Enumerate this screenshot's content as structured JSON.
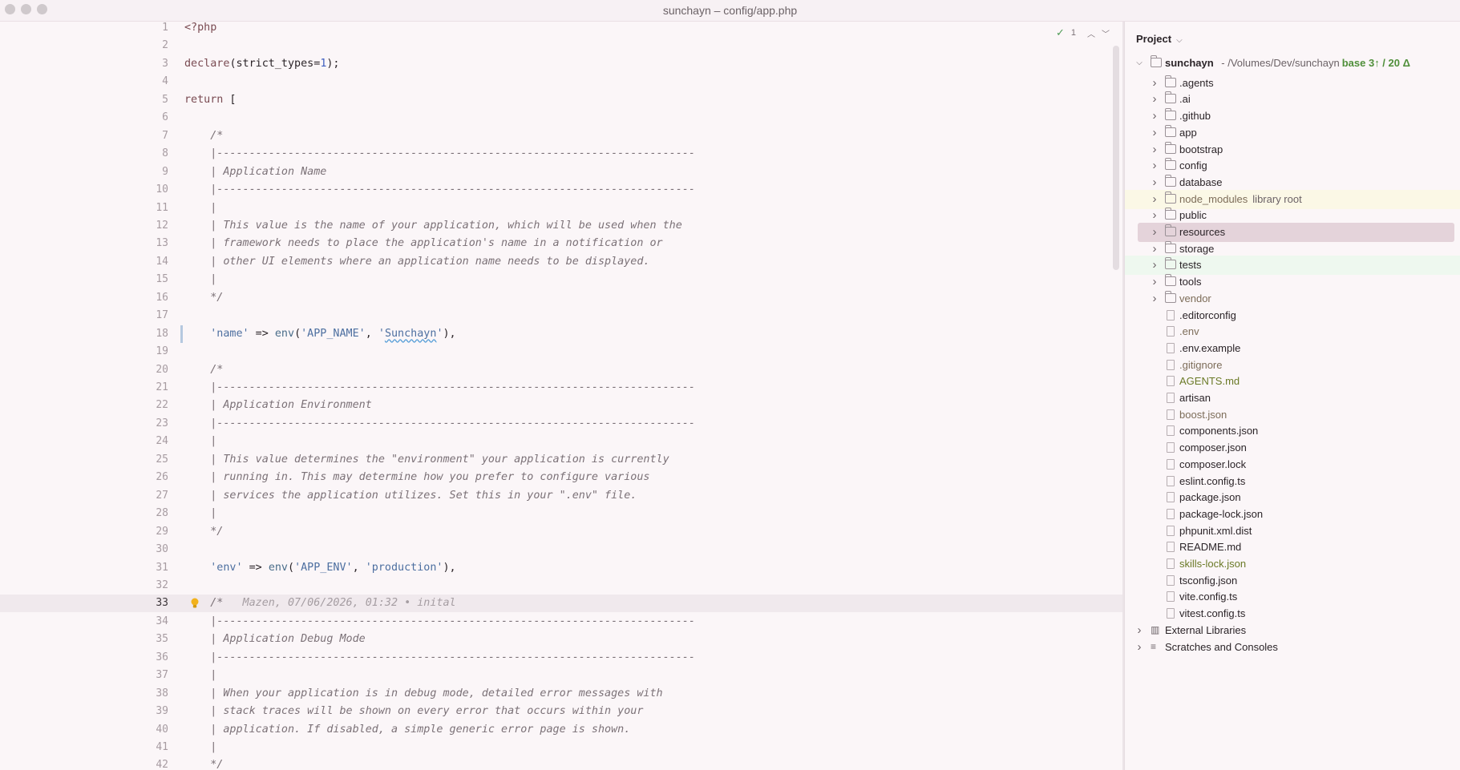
{
  "window": {
    "title": "sunchayn – config/app.php"
  },
  "editor": {
    "inspection_count": "1",
    "current_line": 33,
    "lines": [
      {
        "n": "1",
        "segs": [
          {
            "t": "<?php",
            "c": "c-kw"
          }
        ]
      },
      {
        "n": "2",
        "segs": []
      },
      {
        "n": "3",
        "segs": [
          {
            "t": "declare",
            "c": "c-kw"
          },
          {
            "t": "(strict_types=",
            "c": ""
          },
          {
            "t": "1",
            "c": "c-num"
          },
          {
            "t": ");",
            "c": ""
          }
        ]
      },
      {
        "n": "4",
        "segs": []
      },
      {
        "n": "5",
        "segs": [
          {
            "t": "return",
            "c": "c-kw"
          },
          {
            "t": " [",
            "c": ""
          }
        ]
      },
      {
        "n": "6",
        "segs": []
      },
      {
        "n": "7",
        "segs": [
          {
            "t": "    /*",
            "c": "c-comment"
          }
        ]
      },
      {
        "n": "8",
        "segs": [
          {
            "t": "    |--------------------------------------------------------------------------",
            "c": "c-comment"
          }
        ]
      },
      {
        "n": "9",
        "segs": [
          {
            "t": "    | Application Name",
            "c": "c-comment"
          }
        ]
      },
      {
        "n": "10",
        "segs": [
          {
            "t": "    |--------------------------------------------------------------------------",
            "c": "c-comment"
          }
        ]
      },
      {
        "n": "11",
        "segs": [
          {
            "t": "    |",
            "c": "c-comment"
          }
        ]
      },
      {
        "n": "12",
        "segs": [
          {
            "t": "    | This value is the name of your application, which will be used when the",
            "c": "c-comment"
          }
        ]
      },
      {
        "n": "13",
        "segs": [
          {
            "t": "    | framework needs to place the application's name in a notification or",
            "c": "c-comment"
          }
        ]
      },
      {
        "n": "14",
        "segs": [
          {
            "t": "    | other UI elements where an application name needs to be displayed.",
            "c": "c-comment"
          }
        ]
      },
      {
        "n": "15",
        "segs": [
          {
            "t": "    |",
            "c": "c-comment"
          }
        ]
      },
      {
        "n": "16",
        "segs": [
          {
            "t": "    */",
            "c": "c-comment"
          }
        ]
      },
      {
        "n": "17",
        "segs": []
      },
      {
        "n": "18",
        "segs": [
          {
            "t": "    ",
            "c": ""
          },
          {
            "t": "'name'",
            "c": "c-str"
          },
          {
            "t": " => ",
            "c": ""
          },
          {
            "t": "env",
            "c": "c-fn"
          },
          {
            "t": "(",
            "c": ""
          },
          {
            "t": "'APP_NAME'",
            "c": "c-str"
          },
          {
            "t": ", ",
            "c": ""
          },
          {
            "t": "'",
            "c": "c-str"
          },
          {
            "t": "Sunchayn",
            "c": "c-str squiggle"
          },
          {
            "t": "'",
            "c": "c-str"
          },
          {
            "t": "),",
            "c": ""
          }
        ],
        "changed": true
      },
      {
        "n": "19",
        "segs": []
      },
      {
        "n": "20",
        "segs": [
          {
            "t": "    /*",
            "c": "c-comment"
          }
        ]
      },
      {
        "n": "21",
        "segs": [
          {
            "t": "    |--------------------------------------------------------------------------",
            "c": "c-comment"
          }
        ]
      },
      {
        "n": "22",
        "segs": [
          {
            "t": "    | Application Environment",
            "c": "c-comment"
          }
        ]
      },
      {
        "n": "23",
        "segs": [
          {
            "t": "    |--------------------------------------------------------------------------",
            "c": "c-comment"
          }
        ]
      },
      {
        "n": "24",
        "segs": [
          {
            "t": "    |",
            "c": "c-comment"
          }
        ]
      },
      {
        "n": "25",
        "segs": [
          {
            "t": "    | This value determines the \"environment\" your application is currently",
            "c": "c-comment"
          }
        ]
      },
      {
        "n": "26",
        "segs": [
          {
            "t": "    | running in. This may determine how you prefer to configure various",
            "c": "c-comment"
          }
        ]
      },
      {
        "n": "27",
        "segs": [
          {
            "t": "    | services the application utilizes. Set this in your \".env\" file.",
            "c": "c-comment"
          }
        ]
      },
      {
        "n": "28",
        "segs": [
          {
            "t": "    |",
            "c": "c-comment"
          }
        ]
      },
      {
        "n": "29",
        "segs": [
          {
            "t": "    */",
            "c": "c-comment"
          }
        ]
      },
      {
        "n": "30",
        "segs": []
      },
      {
        "n": "31",
        "segs": [
          {
            "t": "    ",
            "c": ""
          },
          {
            "t": "'env'",
            "c": "c-str"
          },
          {
            "t": " => ",
            "c": ""
          },
          {
            "t": "env",
            "c": "c-fn"
          },
          {
            "t": "(",
            "c": ""
          },
          {
            "t": "'APP_ENV'",
            "c": "c-str"
          },
          {
            "t": ", ",
            "c": ""
          },
          {
            "t": "'production'",
            "c": "c-str"
          },
          {
            "t": "),",
            "c": ""
          }
        ]
      },
      {
        "n": "32",
        "segs": []
      },
      {
        "n": "33",
        "segs": [
          {
            "t": "    /*",
            "c": "c-comment"
          },
          {
            "t": "   Mazen, 07/06/2026, 01:32 • inital",
            "c": "c-inlay"
          }
        ],
        "bulb": true
      },
      {
        "n": "34",
        "segs": [
          {
            "t": "    |--------------------------------------------------------------------------",
            "c": "c-comment"
          }
        ]
      },
      {
        "n": "35",
        "segs": [
          {
            "t": "    | Application Debug Mode",
            "c": "c-comment"
          }
        ]
      },
      {
        "n": "36",
        "segs": [
          {
            "t": "    |--------------------------------------------------------------------------",
            "c": "c-comment"
          }
        ]
      },
      {
        "n": "37",
        "segs": [
          {
            "t": "    |",
            "c": "c-comment"
          }
        ]
      },
      {
        "n": "38",
        "segs": [
          {
            "t": "    | When your application is in debug mode, detailed error messages with",
            "c": "c-comment"
          }
        ]
      },
      {
        "n": "39",
        "segs": [
          {
            "t": "    | stack traces will be shown on every error that occurs within your",
            "c": "c-comment"
          }
        ]
      },
      {
        "n": "40",
        "segs": [
          {
            "t": "    | application. If disabled, a simple generic error page is shown.",
            "c": "c-comment"
          }
        ]
      },
      {
        "n": "41",
        "segs": [
          {
            "t": "    |",
            "c": "c-comment"
          }
        ]
      },
      {
        "n": "42",
        "segs": [
          {
            "t": "    */",
            "c": "c-comment"
          }
        ]
      }
    ]
  },
  "project": {
    "header": "Project",
    "root": {
      "name": "sunchayn",
      "path": " - /Volumes/Dev/sunchayn",
      "vcs": "base 3↑ / 20 Δ"
    },
    "items": [
      {
        "label": ".agents",
        "kind": "folder",
        "expandable": true,
        "name": "tree-item-agents"
      },
      {
        "label": ".ai",
        "kind": "folder",
        "expandable": true,
        "name": "tree-item-ai"
      },
      {
        "label": ".github",
        "kind": "folder",
        "expandable": true,
        "name": "tree-item-github"
      },
      {
        "label": "app",
        "kind": "folder",
        "expandable": true,
        "name": "tree-item-app"
      },
      {
        "label": "bootstrap",
        "kind": "folder",
        "expandable": true,
        "name": "tree-item-bootstrap"
      },
      {
        "label": "config",
        "kind": "folder",
        "expandable": true,
        "name": "tree-item-config"
      },
      {
        "label": "database",
        "kind": "folder",
        "expandable": true,
        "name": "tree-item-database"
      },
      {
        "label": "node_modules",
        "kind": "folder",
        "expandable": true,
        "extra": "library root",
        "row": "yellow",
        "style": "muted",
        "name": "tree-item-node-modules"
      },
      {
        "label": "public",
        "kind": "folder",
        "expandable": true,
        "name": "tree-item-public"
      },
      {
        "label": "resources",
        "kind": "folder",
        "expandable": true,
        "row": "selected",
        "name": "tree-item-resources"
      },
      {
        "label": "storage",
        "kind": "folder",
        "expandable": true,
        "name": "tree-item-storage"
      },
      {
        "label": "tests",
        "kind": "folder",
        "expandable": true,
        "row": "green",
        "name": "tree-item-tests"
      },
      {
        "label": "tools",
        "kind": "folder",
        "expandable": true,
        "name": "tree-item-tools"
      },
      {
        "label": "vendor",
        "kind": "folder",
        "expandable": true,
        "style": "muted",
        "name": "tree-item-vendor"
      },
      {
        "label": ".editorconfig",
        "kind": "file",
        "name": "tree-item-editorconfig"
      },
      {
        "label": ".env",
        "kind": "file",
        "style": "muted",
        "name": "tree-item-env"
      },
      {
        "label": ".env.example",
        "kind": "file",
        "name": "tree-item-env-example"
      },
      {
        "label": ".gitignore",
        "kind": "file",
        "style": "muted",
        "name": "tree-item-gitignore"
      },
      {
        "label": "AGENTS.md",
        "kind": "file",
        "style": "olive",
        "name": "tree-item-agents-md"
      },
      {
        "label": "artisan",
        "kind": "file",
        "name": "tree-item-artisan"
      },
      {
        "label": "boost.json",
        "kind": "file",
        "style": "muted",
        "name": "tree-item-boost-json"
      },
      {
        "label": "components.json",
        "kind": "file",
        "name": "tree-item-components-json"
      },
      {
        "label": "composer.json",
        "kind": "file",
        "name": "tree-item-composer-json"
      },
      {
        "label": "composer.lock",
        "kind": "file",
        "name": "tree-item-composer-lock"
      },
      {
        "label": "eslint.config.ts",
        "kind": "file",
        "name": "tree-item-eslint-config"
      },
      {
        "label": "package.json",
        "kind": "file",
        "name": "tree-item-package-json"
      },
      {
        "label": "package-lock.json",
        "kind": "file",
        "name": "tree-item-package-lock"
      },
      {
        "label": "phpunit.xml.dist",
        "kind": "file",
        "name": "tree-item-phpunit"
      },
      {
        "label": "README.md",
        "kind": "file",
        "name": "tree-item-readme"
      },
      {
        "label": "skills-lock.json",
        "kind": "file",
        "style": "olive",
        "name": "tree-item-skills-lock"
      },
      {
        "label": "tsconfig.json",
        "kind": "file",
        "name": "tree-item-tsconfig"
      },
      {
        "label": "vite.config.ts",
        "kind": "file",
        "name": "tree-item-vite-config"
      },
      {
        "label": "vitest.config.ts",
        "kind": "file",
        "name": "tree-item-vitest-config"
      }
    ],
    "bottom": [
      {
        "label": "External Libraries",
        "name": "tree-item-external-libraries"
      },
      {
        "label": "Scratches and Consoles",
        "name": "tree-item-scratches"
      }
    ]
  }
}
